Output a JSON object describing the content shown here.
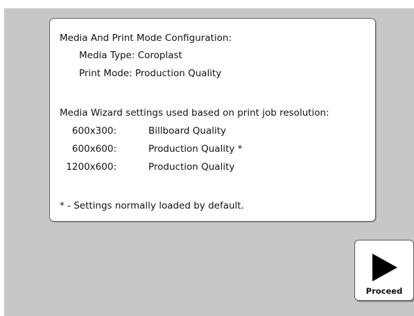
{
  "config": {
    "heading": "Media And Print Mode Configuration:",
    "media_type": "Media Type: Coroplast",
    "print_mode": "Print Mode: Production Quality",
    "wizard_heading": "Media Wizard settings used based on print job resolution:",
    "resolutions": [
      {
        "resolution": "600x300:",
        "quality": "Billboard Quality"
      },
      {
        "resolution": "600x600:",
        "quality": "Production Quality *"
      },
      {
        "resolution": "1200x600:",
        "quality": "Production Quality"
      }
    ],
    "footnote": "* - Settings normally loaded by default."
  },
  "proceed": {
    "label": "Proceed",
    "icon": "play-icon"
  }
}
